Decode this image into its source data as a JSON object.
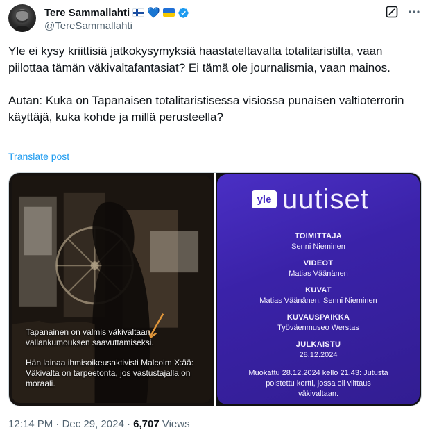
{
  "author": {
    "display_name": "Tere Sammallahti",
    "handle": "@TereSammallahti",
    "badges": [
      "finland-flag-icon",
      "blue-heart-icon",
      "ukraine-flag-icon",
      "verified-badge-icon"
    ],
    "heart": "💙"
  },
  "tweet": {
    "paragraph_1": "Yle ei kysy kriittisiä jatkokysymyksiä haastateltavalta totalitaristilta, vaan piilottaa tämän väkivaltafantasiat? Ei tämä ole journalismia, vaan mainos.",
    "paragraph_2": "Autan: Kuka on Tapanaisen totalitaristisessa visiossa punaisen valtioterrorin käyttäjä, kuka kohde ja millä perusteella?",
    "translate_label": "Translate post"
  },
  "media": {
    "left_caption_1": "Tapanainen on valmis väkivaltaan vallankumouksen saavuttamiseksi.",
    "left_caption_2": "Hän lainaa ihmisoikeusaktivisti Malcolm X:ää: Väkivalta on tarpeetonta, jos vastustajalla on moraali.",
    "right_card": {
      "yle_logo_text": "yle",
      "brand": "uutiset",
      "credits": [
        {
          "label": "TOIMITTAJA",
          "value": "Senni Nieminen"
        },
        {
          "label": "VIDEOT",
          "value": "Matias Väänänen"
        },
        {
          "label": "KUVAT",
          "value": "Matias Väänänen, Senni Nieminen"
        },
        {
          "label": "KUVAUSPAIKKA",
          "value": "Työväenmuseo Werstas"
        },
        {
          "label": "JULKAISTU",
          "value": "28.12.2024"
        }
      ],
      "edit_note": "Muokattu 28.12.2024 kello 21.43: Jutusta poistettu kortti, jossa oli viittaus väkivaltaan."
    }
  },
  "meta": {
    "time": "12:14 PM",
    "separator": "·",
    "date": "Dec 29, 2024",
    "views_count": "6,707",
    "views_label": "Views"
  },
  "colors": {
    "text": "#0f1419",
    "secondary": "#536471",
    "link": "#1d9bf0",
    "verified": "#1d9bf0",
    "card_purple": "#3a22a8"
  }
}
